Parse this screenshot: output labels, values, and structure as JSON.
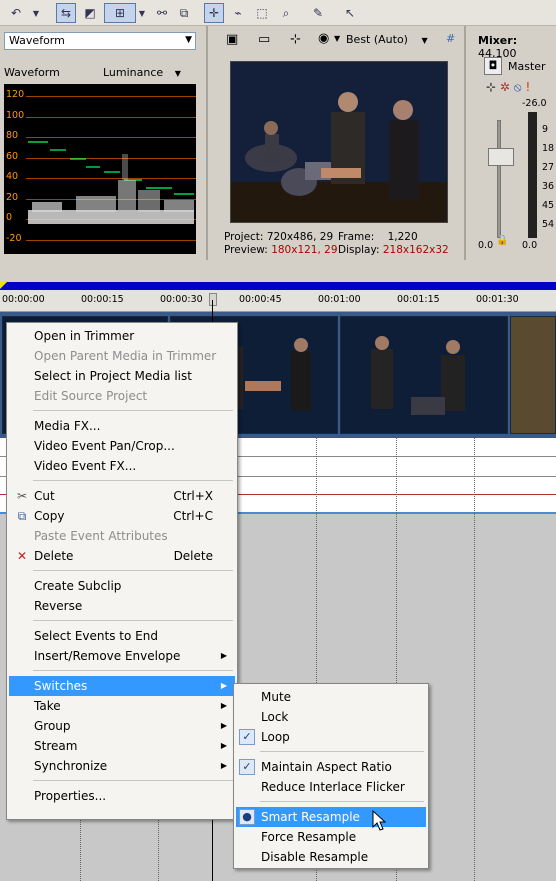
{
  "scope": {
    "mode": "Waveform",
    "label": "Waveform",
    "channel": "Luminance",
    "levels": [
      "120",
      "100",
      "80",
      "60",
      "40",
      "20",
      "0",
      "-20"
    ]
  },
  "preview": {
    "quality": "Best (Auto)",
    "project_label": "Project:",
    "project_value": "720x486, 29",
    "frame_label": "Frame:",
    "frame_value": "1,220",
    "preview_label": "Preview:",
    "preview_value": "180x121, 29",
    "display_label": "Display:",
    "display_value": "218x162x32"
  },
  "mixer": {
    "title": "Mixer:",
    "rate": "44,100",
    "master": "Master",
    "peak": "-26.0",
    "scale": [
      "9",
      "18",
      "27",
      "36",
      "45",
      "54"
    ],
    "fader_value": "0.0",
    "meter_value": "0.0"
  },
  "ruler": [
    "00:00:00",
    "00:00:15",
    "00:00:30",
    "00:00:45",
    "00:01:00",
    "00:01:15",
    "00:01:30"
  ],
  "context_menu": {
    "items": [
      {
        "label": "Open in Trimmer",
        "shortcut": "",
        "disabled": false
      },
      {
        "label": "Open Parent Media in Trimmer",
        "shortcut": "",
        "disabled": true
      },
      {
        "label": "Select in Project Media list",
        "shortcut": "",
        "disabled": false
      },
      {
        "label": "Edit Source Project",
        "shortcut": "",
        "disabled": true
      },
      {
        "label": "Media FX...",
        "shortcut": "",
        "disabled": false
      },
      {
        "label": "Video Event Pan/Crop...",
        "shortcut": "",
        "disabled": false
      },
      {
        "label": "Video Event FX...",
        "shortcut": "",
        "disabled": false
      },
      {
        "label": "Cut",
        "shortcut": "Ctrl+X",
        "disabled": false
      },
      {
        "label": "Copy",
        "shortcut": "Ctrl+C",
        "disabled": false
      },
      {
        "label": "Paste Event Attributes",
        "shortcut": "",
        "disabled": true
      },
      {
        "label": "Delete",
        "shortcut": "Delete",
        "disabled": false
      },
      {
        "label": "Create Subclip",
        "shortcut": "",
        "disabled": false
      },
      {
        "label": "Reverse",
        "shortcut": "",
        "disabled": false
      },
      {
        "label": "Select Events to End",
        "shortcut": "",
        "disabled": false
      },
      {
        "label": "Insert/Remove Envelope",
        "shortcut": "",
        "disabled": false
      },
      {
        "label": "Switches",
        "shortcut": "",
        "disabled": false
      },
      {
        "label": "Take",
        "shortcut": "",
        "disabled": false
      },
      {
        "label": "Group",
        "shortcut": "",
        "disabled": false
      },
      {
        "label": "Stream",
        "shortcut": "",
        "disabled": false
      },
      {
        "label": "Synchronize",
        "shortcut": "",
        "disabled": false
      },
      {
        "label": "Properties...",
        "shortcut": "",
        "disabled": false
      }
    ]
  },
  "switches_menu": {
    "items": [
      {
        "label": "Mute",
        "checked": false
      },
      {
        "label": "Lock",
        "checked": false
      },
      {
        "label": "Loop",
        "checked": true
      },
      {
        "label": "Maintain Aspect Ratio",
        "checked": true
      },
      {
        "label": "Reduce Interlace Flicker",
        "checked": false
      },
      {
        "label": "Smart Resample",
        "checked": true
      },
      {
        "label": "Force Resample",
        "checked": false
      },
      {
        "label": "Disable Resample",
        "checked": false
      }
    ]
  },
  "colors": {
    "menu_highlight": "#3399ff",
    "timeline_marker": "#0000c8",
    "scope_trace": "#00ff66",
    "scope_grid": "#ff9900"
  }
}
